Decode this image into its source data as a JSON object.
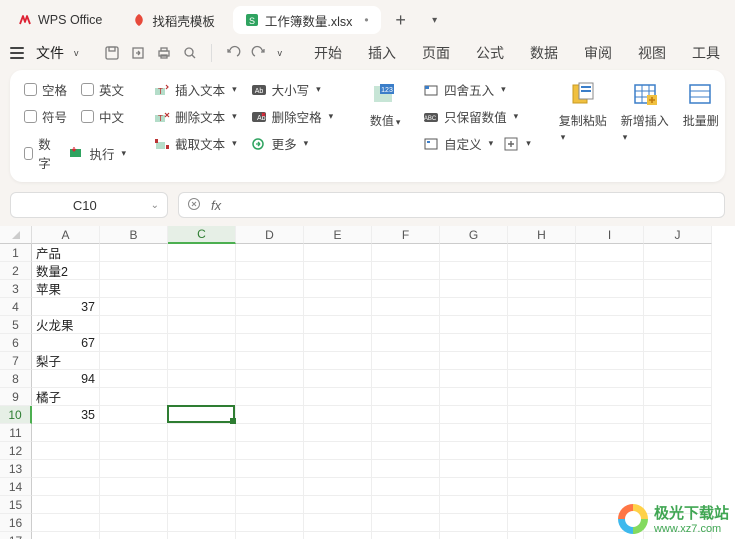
{
  "tabs": {
    "t0": {
      "label": "WPS Office"
    },
    "t1": {
      "label": "找稻壳模板"
    },
    "t2": {
      "label": "工作簿数量.xlsx"
    }
  },
  "menu": {
    "file": "文件",
    "items": [
      "开始",
      "插入",
      "页面",
      "公式",
      "数据",
      "审阅",
      "视图",
      "工具"
    ]
  },
  "ribbon": {
    "checks": {
      "space": "空格",
      "english": "英文",
      "symbol": "符号",
      "chinese": "中文",
      "number": "数字",
      "exec": "执行"
    },
    "text": {
      "insert": "插入文本",
      "delete": "删除文本",
      "extract": "截取文本",
      "case": "大小写",
      "blanks": "删除空格",
      "more": "更多"
    },
    "num": {
      "value": "数值",
      "round": "四舍五入",
      "keep": "只保留数值",
      "custom": "自定义"
    },
    "big": {
      "copy": "复制粘贴",
      "add": "新增插入",
      "batch": "批量删"
    }
  },
  "fbar": {
    "name": "C10",
    "fx": "fx"
  },
  "cols": [
    "A",
    "B",
    "C",
    "D",
    "E",
    "F",
    "G",
    "H",
    "I",
    "J"
  ],
  "cells": {
    "A1": "产品",
    "A2": "数量2",
    "A3": "苹果",
    "A4": "37",
    "A5": "火龙果",
    "A6": "67",
    "A7": "梨子",
    "A8": "94",
    "A9": "橘子",
    "A10": "35"
  },
  "selected": {
    "cell": "C10",
    "colIdx": 2,
    "rowIdx": 9
  },
  "rows": 18,
  "watermark": {
    "title": "极光下载站",
    "url": "www.xz7.com"
  }
}
